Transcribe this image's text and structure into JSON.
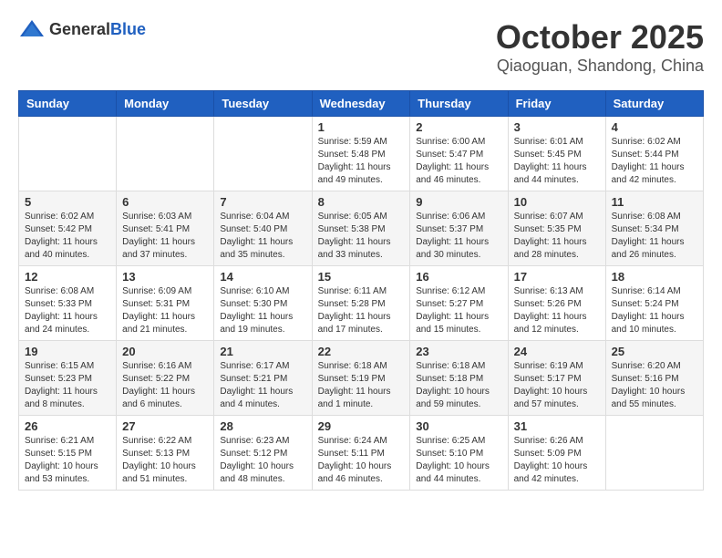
{
  "header": {
    "logo_general": "General",
    "logo_blue": "Blue",
    "month": "October 2025",
    "location": "Qiaoguan, Shandong, China"
  },
  "weekdays": [
    "Sunday",
    "Monday",
    "Tuesday",
    "Wednesday",
    "Thursday",
    "Friday",
    "Saturday"
  ],
  "weeks": [
    [
      {
        "day": "",
        "info": ""
      },
      {
        "day": "",
        "info": ""
      },
      {
        "day": "",
        "info": ""
      },
      {
        "day": "1",
        "info": "Sunrise: 5:59 AM\nSunset: 5:48 PM\nDaylight: 11 hours and 49 minutes."
      },
      {
        "day": "2",
        "info": "Sunrise: 6:00 AM\nSunset: 5:47 PM\nDaylight: 11 hours and 46 minutes."
      },
      {
        "day": "3",
        "info": "Sunrise: 6:01 AM\nSunset: 5:45 PM\nDaylight: 11 hours and 44 minutes."
      },
      {
        "day": "4",
        "info": "Sunrise: 6:02 AM\nSunset: 5:44 PM\nDaylight: 11 hours and 42 minutes."
      }
    ],
    [
      {
        "day": "5",
        "info": "Sunrise: 6:02 AM\nSunset: 5:42 PM\nDaylight: 11 hours and 40 minutes."
      },
      {
        "day": "6",
        "info": "Sunrise: 6:03 AM\nSunset: 5:41 PM\nDaylight: 11 hours and 37 minutes."
      },
      {
        "day": "7",
        "info": "Sunrise: 6:04 AM\nSunset: 5:40 PM\nDaylight: 11 hours and 35 minutes."
      },
      {
        "day": "8",
        "info": "Sunrise: 6:05 AM\nSunset: 5:38 PM\nDaylight: 11 hours and 33 minutes."
      },
      {
        "day": "9",
        "info": "Sunrise: 6:06 AM\nSunset: 5:37 PM\nDaylight: 11 hours and 30 minutes."
      },
      {
        "day": "10",
        "info": "Sunrise: 6:07 AM\nSunset: 5:35 PM\nDaylight: 11 hours and 28 minutes."
      },
      {
        "day": "11",
        "info": "Sunrise: 6:08 AM\nSunset: 5:34 PM\nDaylight: 11 hours and 26 minutes."
      }
    ],
    [
      {
        "day": "12",
        "info": "Sunrise: 6:08 AM\nSunset: 5:33 PM\nDaylight: 11 hours and 24 minutes."
      },
      {
        "day": "13",
        "info": "Sunrise: 6:09 AM\nSunset: 5:31 PM\nDaylight: 11 hours and 21 minutes."
      },
      {
        "day": "14",
        "info": "Sunrise: 6:10 AM\nSunset: 5:30 PM\nDaylight: 11 hours and 19 minutes."
      },
      {
        "day": "15",
        "info": "Sunrise: 6:11 AM\nSunset: 5:28 PM\nDaylight: 11 hours and 17 minutes."
      },
      {
        "day": "16",
        "info": "Sunrise: 6:12 AM\nSunset: 5:27 PM\nDaylight: 11 hours and 15 minutes."
      },
      {
        "day": "17",
        "info": "Sunrise: 6:13 AM\nSunset: 5:26 PM\nDaylight: 11 hours and 12 minutes."
      },
      {
        "day": "18",
        "info": "Sunrise: 6:14 AM\nSunset: 5:24 PM\nDaylight: 11 hours and 10 minutes."
      }
    ],
    [
      {
        "day": "19",
        "info": "Sunrise: 6:15 AM\nSunset: 5:23 PM\nDaylight: 11 hours and 8 minutes."
      },
      {
        "day": "20",
        "info": "Sunrise: 6:16 AM\nSunset: 5:22 PM\nDaylight: 11 hours and 6 minutes."
      },
      {
        "day": "21",
        "info": "Sunrise: 6:17 AM\nSunset: 5:21 PM\nDaylight: 11 hours and 4 minutes."
      },
      {
        "day": "22",
        "info": "Sunrise: 6:18 AM\nSunset: 5:19 PM\nDaylight: 11 hours and 1 minute."
      },
      {
        "day": "23",
        "info": "Sunrise: 6:18 AM\nSunset: 5:18 PM\nDaylight: 10 hours and 59 minutes."
      },
      {
        "day": "24",
        "info": "Sunrise: 6:19 AM\nSunset: 5:17 PM\nDaylight: 10 hours and 57 minutes."
      },
      {
        "day": "25",
        "info": "Sunrise: 6:20 AM\nSunset: 5:16 PM\nDaylight: 10 hours and 55 minutes."
      }
    ],
    [
      {
        "day": "26",
        "info": "Sunrise: 6:21 AM\nSunset: 5:15 PM\nDaylight: 10 hours and 53 minutes."
      },
      {
        "day": "27",
        "info": "Sunrise: 6:22 AM\nSunset: 5:13 PM\nDaylight: 10 hours and 51 minutes."
      },
      {
        "day": "28",
        "info": "Sunrise: 6:23 AM\nSunset: 5:12 PM\nDaylight: 10 hours and 48 minutes."
      },
      {
        "day": "29",
        "info": "Sunrise: 6:24 AM\nSunset: 5:11 PM\nDaylight: 10 hours and 46 minutes."
      },
      {
        "day": "30",
        "info": "Sunrise: 6:25 AM\nSunset: 5:10 PM\nDaylight: 10 hours and 44 minutes."
      },
      {
        "day": "31",
        "info": "Sunrise: 6:26 AM\nSunset: 5:09 PM\nDaylight: 10 hours and 42 minutes."
      },
      {
        "day": "",
        "info": ""
      }
    ]
  ]
}
